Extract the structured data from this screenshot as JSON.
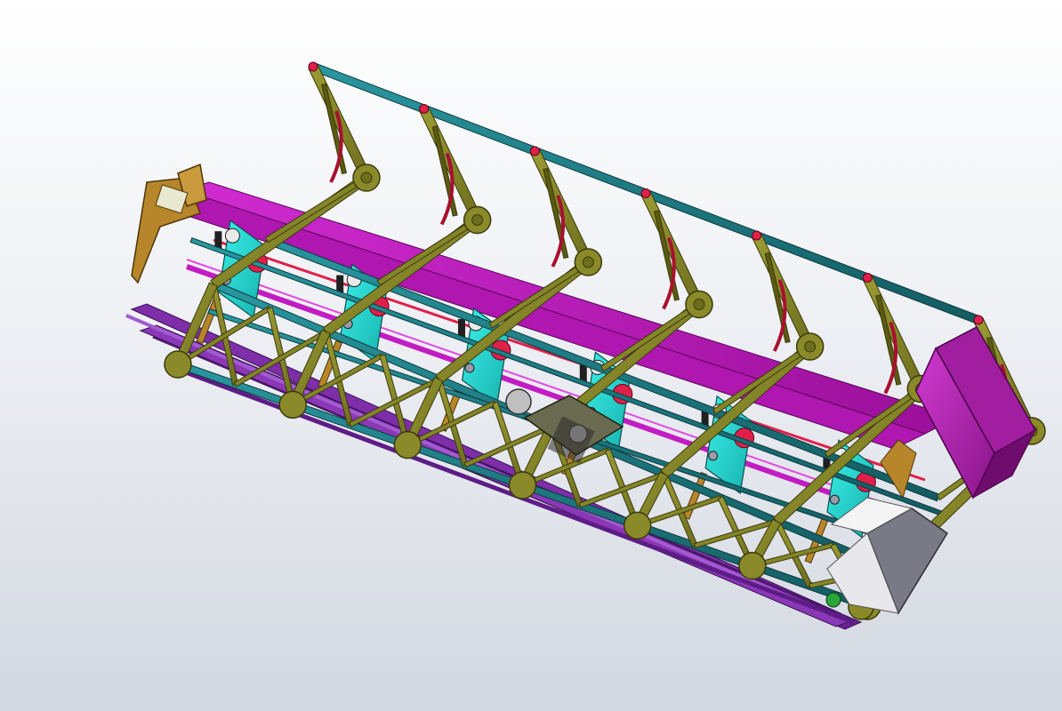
{
  "viewport": {
    "background_top": "#ffffff",
    "background_bottom": "#d3d7e0"
  },
  "model": {
    "description_icon": "3d-assembly-icon",
    "colors": {
      "frame": "#8a8a2a",
      "frame_edge": "#3b3b0c",
      "rail": "#1f7f86",
      "rail_edge": "#0b3a3e",
      "panel": "#20d7d2",
      "magenta": "#c21cc2",
      "purple_base": "#7d2ea8",
      "pulley_red": "#e0204a",
      "motor_gray": "#7a7a86",
      "wood": "#b7862a"
    },
    "stations": 6
  }
}
